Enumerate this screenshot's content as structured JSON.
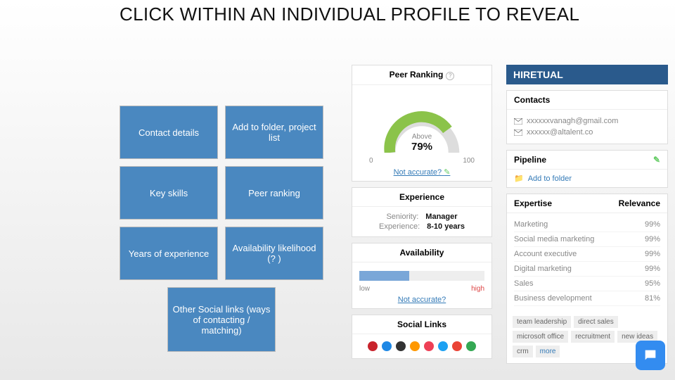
{
  "title": "CLICK WITHIN AN INDIVIDUAL PROFILE TO REVEAL",
  "tiles": {
    "r1c1": "Contact details",
    "r1c2": "Add to folder, project list",
    "r2c1": "Key skills",
    "r2c2": "Peer ranking",
    "r3c1": "Years of experience",
    "r3c2": "Availability likelihood (? )",
    "bottom": "Other Social links (ways of contacting / matching)"
  },
  "peer_ranking": {
    "header": "Peer Ranking",
    "label_above": "Above",
    "percent": "79%",
    "scale_low": "0",
    "scale_high": "100",
    "not_accurate": "Not accurate?"
  },
  "experience": {
    "header": "Experience",
    "seniority_label": "Seniority:",
    "seniority_value": "Manager",
    "years_label": "Experience:",
    "years_value": "8-10 years"
  },
  "availability": {
    "header": "Availability",
    "low": "low",
    "high": "high",
    "not_accurate": "Not accurate?"
  },
  "social_links": {
    "header": "Social Links",
    "icons": [
      {
        "name": "pinterest",
        "color": "#c8232c"
      },
      {
        "name": "stumbleupon",
        "color": "#1e88e5"
      },
      {
        "name": "github",
        "color": "#333333"
      },
      {
        "name": "aboutme",
        "color": "#ff9800"
      },
      {
        "name": "tumblr",
        "color": "#ee4056"
      },
      {
        "name": "twitter",
        "color": "#1da1f2"
      },
      {
        "name": "behance",
        "color": "#ea4335"
      },
      {
        "name": "google",
        "color": "#34a853"
      }
    ]
  },
  "brand": "HIRETUAL",
  "contacts": {
    "header": "Contacts",
    "emails": [
      "xxxxxxvanagh@gmail.com",
      "xxxxxx@altalent.co"
    ]
  },
  "pipeline": {
    "header": "Pipeline",
    "add_folder": "Add to folder"
  },
  "expertise": {
    "col1": "Expertise",
    "col2": "Relevance",
    "rows": [
      {
        "skill": "Marketing",
        "pct": "99%"
      },
      {
        "skill": "Social media marketing",
        "pct": "99%"
      },
      {
        "skill": "Account executive",
        "pct": "99%"
      },
      {
        "skill": "Digital marketing",
        "pct": "99%"
      },
      {
        "skill": "Sales",
        "pct": "95%"
      },
      {
        "skill": "Business development",
        "pct": "81%"
      }
    ]
  },
  "tags_list": [
    "team leadership",
    "direct sales",
    "microsoft office",
    "recruitment",
    "new ideas",
    "crm"
  ],
  "tags_more": "more"
}
